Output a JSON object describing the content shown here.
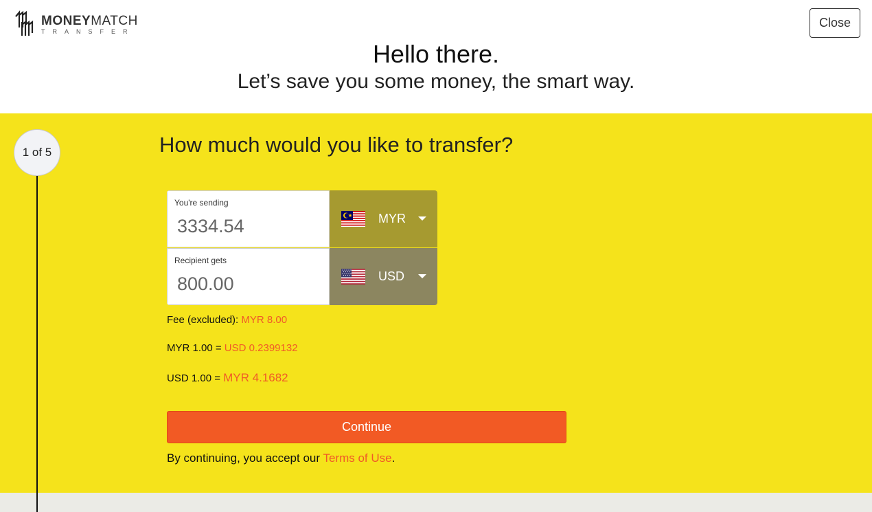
{
  "brand": {
    "name_bold": "MONEY",
    "name_thin": "MATCH",
    "sub": "TRANSFER"
  },
  "header": {
    "close_label": "Close",
    "greeting": "Hello there.",
    "tagline": "Let’s save you some money, the smart way."
  },
  "step": {
    "label": "1 of 5",
    "question": "How much would you like to transfer?"
  },
  "converter": {
    "sending": {
      "label": "You're sending",
      "value": "3334.54",
      "currency": "MYR"
    },
    "receiving": {
      "label": "Recipient gets",
      "value": "800.00",
      "currency": "USD"
    }
  },
  "rates": {
    "fee_label": "Fee (excluded):",
    "fee_value": "MYR 8.00",
    "rate1_label": "MYR 1.00 =",
    "rate1_value": "USD 0.2399132",
    "rate2_label": "USD 1.00 =",
    "rate2_value": "MYR 4.1682"
  },
  "actions": {
    "continue_label": "Continue",
    "terms_prefix": "By continuing, you accept our",
    "terms_link": "Terms of Use",
    "terms_suffix": "."
  },
  "colors": {
    "main_bg": "#f5e31b",
    "accent": "#f05a28",
    "button": "#f25a24",
    "myr_box": "#a69a30",
    "usd_box": "#8c8660"
  }
}
